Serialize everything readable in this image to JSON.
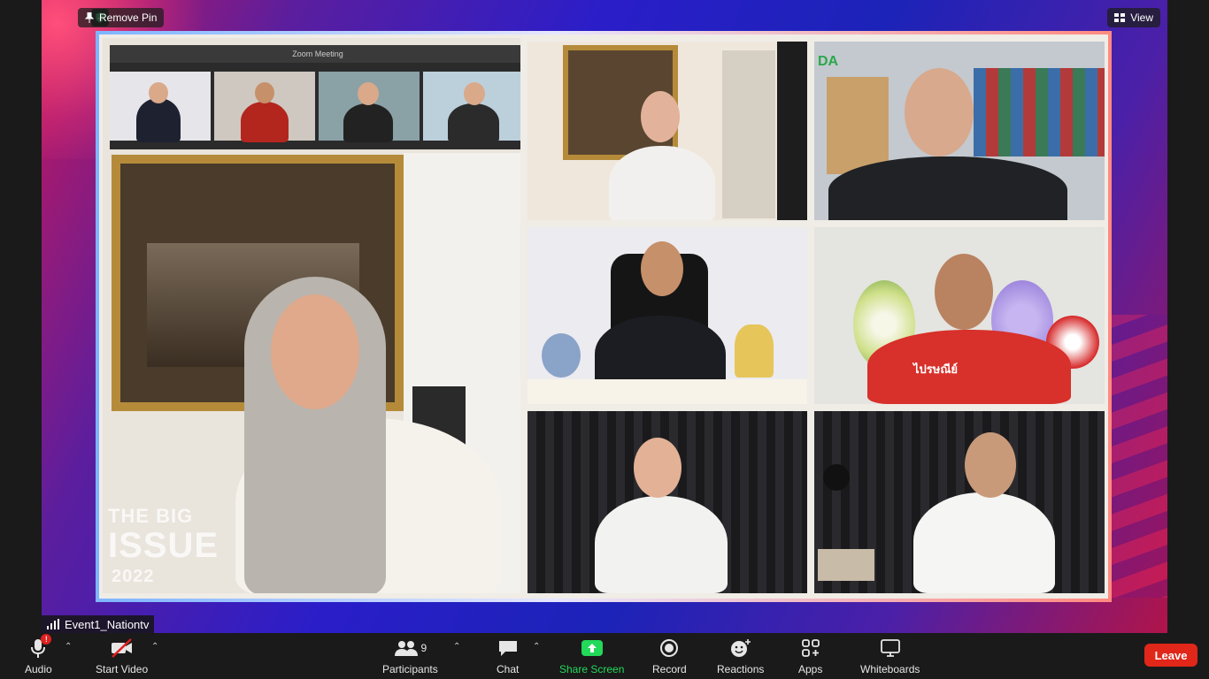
{
  "window": {
    "remove_pin_label": "Remove Pin",
    "view_label": "View",
    "meeting_strip_title": "Zoom Meeting"
  },
  "participant": {
    "name": "Event1_Nationtv"
  },
  "video_overlay": {
    "line1": "THE BIG",
    "line2": "ISSUE",
    "line3": "2022",
    "sponsor_text": "DA",
    "jacket_text": "ไปรษณีย์"
  },
  "toolbar": {
    "audio_label": "Audio",
    "video_label": "Start Video",
    "participants_label": "Participants",
    "participants_count": "9",
    "chat_label": "Chat",
    "share_label": "Share Screen",
    "record_label": "Record",
    "reactions_label": "Reactions",
    "apps_label": "Apps",
    "whiteboards_label": "Whiteboards",
    "leave_label": "Leave",
    "audio_badge": "!"
  },
  "colors": {
    "share_green": "#23d95a",
    "leave_red": "#e0271a",
    "shield_green": "#2ecc71"
  }
}
